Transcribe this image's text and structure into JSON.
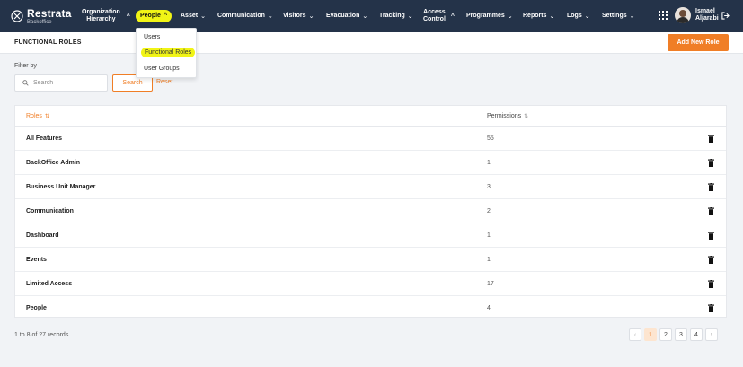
{
  "brand": {
    "name": "Restrata",
    "sub": "Backoffice"
  },
  "nav": {
    "items": [
      {
        "label": "Organization",
        "label2": "Hierarchy",
        "chevron": "^",
        "active": false
      },
      {
        "label": "People",
        "chevron": "^",
        "active": true
      },
      {
        "label": "Asset",
        "chevron": "v",
        "active": false
      },
      {
        "label": "Communication",
        "chevron": "v",
        "active": false
      },
      {
        "label": "Visitors",
        "chevron": "v",
        "active": false
      },
      {
        "label": "Evacuation",
        "chevron": "v",
        "active": false
      },
      {
        "label": "Tracking",
        "chevron": "v",
        "active": false
      },
      {
        "label": "Access",
        "label2": "Control",
        "chevron": "^",
        "active": false
      },
      {
        "label": "Programmes",
        "chevron": "v",
        "active": false
      },
      {
        "label": "Reports",
        "chevron": "v",
        "active": false
      },
      {
        "label": "Logs",
        "chevron": "v",
        "active": false
      },
      {
        "label": "Settings",
        "chevron": "v",
        "active": false
      }
    ],
    "user": {
      "first": "Ismael",
      "last": "Aljarabi"
    }
  },
  "dropdown": {
    "items": [
      "Users",
      "Functional Roles",
      "User Groups"
    ],
    "highlighted": "Functional Roles"
  },
  "header": {
    "title": "FUNCTIONAL ROLES",
    "add_button": "Add New Role"
  },
  "filter": {
    "label": "Filter by",
    "search_placeholder": "Search",
    "search_button": "Search",
    "reset": "Reset"
  },
  "table": {
    "columns": [
      "Roles",
      "Permissions"
    ],
    "rows": [
      {
        "role": "All Features",
        "permissions": "55"
      },
      {
        "role": "BackOffice Admin",
        "permissions": "1"
      },
      {
        "role": "Business Unit Manager",
        "permissions": "3"
      },
      {
        "role": "Communication",
        "permissions": "2"
      },
      {
        "role": "Dashboard",
        "permissions": "1"
      },
      {
        "role": "Events",
        "permissions": "1"
      },
      {
        "role": "Limited Access",
        "permissions": "17"
      },
      {
        "role": "People",
        "permissions": "4"
      }
    ]
  },
  "footer": {
    "records": "1 to 8 of 27 records",
    "pages": [
      "1",
      "2",
      "3",
      "4"
    ],
    "current_page": "1",
    "prev": "‹",
    "next": "›"
  },
  "colors": {
    "nav_bg": "#243349",
    "accent": "#f07e26",
    "highlight": "#f1f416"
  }
}
